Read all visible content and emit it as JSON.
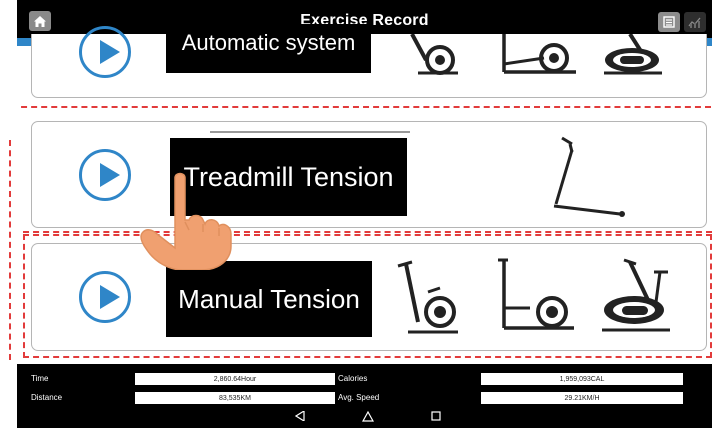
{
  "header": {
    "title": "Exercise Record",
    "home_icon": "home-icon",
    "list_icon": "list-icon",
    "chart_icon": "chart-icon"
  },
  "modes": [
    {
      "label": "Automatic system"
    },
    {
      "label": "Treadmill  Tension"
    },
    {
      "label": "Manual Tension"
    }
  ],
  "stats": {
    "time_label": "Time",
    "time_value": "2,860.64Hour",
    "calories_label": "Calories",
    "calories_value": "1,959,093CAL",
    "distance_label": "Distance",
    "distance_value": "83,535KM",
    "speed_label": "Avg. Speed",
    "speed_value": "29.21KM/H"
  },
  "colors": {
    "accent": "#2f86c8",
    "highlight": "#e23b3b",
    "hand": "#f0a070"
  }
}
